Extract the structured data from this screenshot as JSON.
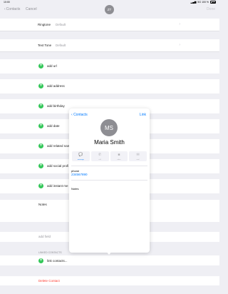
{
  "status_bar": {
    "time": "10:00",
    "network": "5G 100 %"
  },
  "nav": {
    "back_label": "Contacts",
    "cancel_label": "Cancel",
    "done_label": "Done",
    "avatar_initials": "ZT"
  },
  "ringtone": {
    "label": "Ringtone",
    "value": "Default"
  },
  "text_tone": {
    "label": "Text Tone",
    "value": "Default"
  },
  "add_items": [
    {
      "label": "add url"
    },
    {
      "label": "add address"
    },
    {
      "label": "add birthday"
    },
    {
      "label": "add date"
    },
    {
      "label": "add related nam"
    },
    {
      "label": "add social profi"
    },
    {
      "label": "add instant me"
    }
  ],
  "notes_label": "Notes",
  "add_field_label": "add field",
  "linked_contacts": {
    "header": "LINKED CONTACTS",
    "link_label": "link contacts..."
  },
  "delete_label": "Delete Contact",
  "popover": {
    "back_label": "Contacts",
    "link_label": "Link",
    "avatar_initials": "MS",
    "name": "Maria Smith",
    "actions": [
      {
        "label": "message",
        "icon": "message-icon"
      },
      {
        "label": "call",
        "icon": "phone-icon"
      },
      {
        "label": "video",
        "icon": "video-icon"
      },
      {
        "label": "mail",
        "icon": "mail-icon"
      }
    ],
    "phone_label": "phone",
    "phone_value": "234567890",
    "notes_label": "Notes"
  },
  "colors": {
    "accent": "#007aff",
    "add_green": "#34c759",
    "delete_red": "#ff3b30"
  }
}
